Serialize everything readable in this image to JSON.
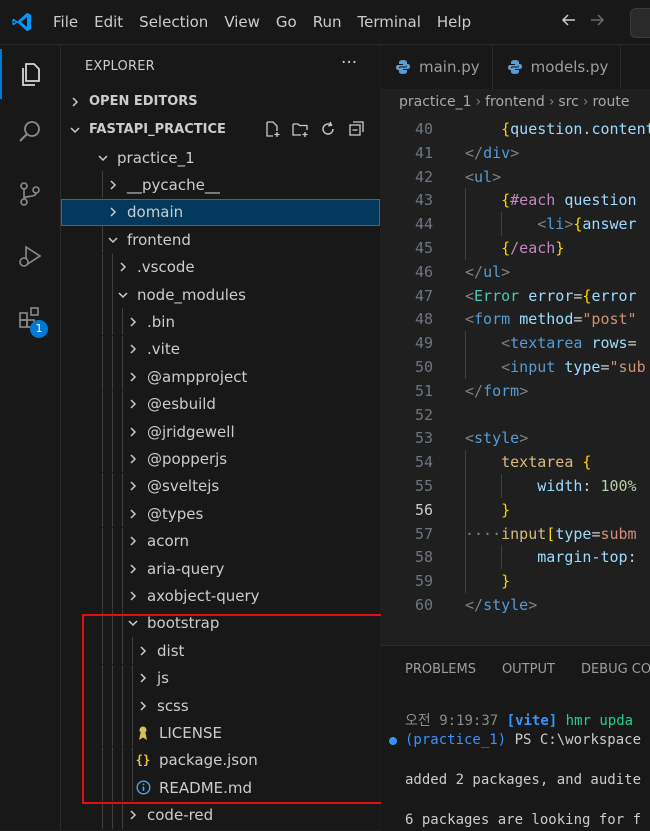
{
  "menu": [
    "File",
    "Edit",
    "Selection",
    "View",
    "Go",
    "Run",
    "Terminal",
    "Help"
  ],
  "activity": {
    "extensions_badge": "1"
  },
  "explorer": {
    "title": "EXPLORER",
    "more": "···",
    "open_editors": "OPEN EDITORS",
    "workspace": "FASTAPI_PRACTICE",
    "tree": [
      {
        "label": "practice_1",
        "depth": 0,
        "expanded": true
      },
      {
        "label": "__pycache__",
        "depth": 1,
        "expanded": false
      },
      {
        "label": "domain",
        "depth": 1,
        "expanded": false,
        "selected": true
      },
      {
        "label": "frontend",
        "depth": 1,
        "expanded": true
      },
      {
        "label": ".vscode",
        "depth": 2,
        "expanded": false
      },
      {
        "label": "node_modules",
        "depth": 2,
        "expanded": true
      },
      {
        "label": ".bin",
        "depth": 3,
        "expanded": false
      },
      {
        "label": ".vite",
        "depth": 3,
        "expanded": false
      },
      {
        "label": "@ampproject",
        "depth": 3,
        "expanded": false
      },
      {
        "label": "@esbuild",
        "depth": 3,
        "expanded": false
      },
      {
        "label": "@jridgewell",
        "depth": 3,
        "expanded": false
      },
      {
        "label": "@popperjs",
        "depth": 3,
        "expanded": false
      },
      {
        "label": "@sveltejs",
        "depth": 3,
        "expanded": false
      },
      {
        "label": "@types",
        "depth": 3,
        "expanded": false
      },
      {
        "label": "acorn",
        "depth": 3,
        "expanded": false
      },
      {
        "label": "aria-query",
        "depth": 3,
        "expanded": false
      },
      {
        "label": "axobject-query",
        "depth": 3,
        "expanded": false
      },
      {
        "label": "bootstrap",
        "depth": 3,
        "expanded": true
      },
      {
        "label": "dist",
        "depth": 4,
        "expanded": false
      },
      {
        "label": "js",
        "depth": 4,
        "expanded": false
      },
      {
        "label": "scss",
        "depth": 4,
        "expanded": false
      },
      {
        "label": "LICENSE",
        "depth": 4,
        "icon": "license-icon"
      },
      {
        "label": "package.json",
        "depth": 4,
        "icon": "json-icon"
      },
      {
        "label": "README.md",
        "depth": 4,
        "icon": "info-icon"
      },
      {
        "label": "code-red",
        "depth": 3,
        "expanded": false
      }
    ]
  },
  "editor": {
    "tabs": [
      "main.py",
      "models.py"
    ],
    "breadcrumb": [
      "practice_1",
      "frontend",
      "src",
      "route"
    ],
    "current_line": 56,
    "lines": [
      {
        "n": 40,
        "t": [
          [
            "",
            "    "
          ],
          [
            "brace",
            "{"
          ],
          [
            "var",
            "question"
          ],
          [
            "plain",
            "."
          ],
          [
            "var",
            "content"
          ]
        ]
      },
      {
        "n": 41,
        "t": [
          [
            "t",
            "</"
          ],
          [
            "tag",
            "div"
          ],
          [
            "t",
            ">"
          ]
        ]
      },
      {
        "n": 42,
        "t": [
          [
            "t",
            "<"
          ],
          [
            "tag",
            "ul"
          ],
          [
            "t",
            ">"
          ]
        ]
      },
      {
        "n": 43,
        "t": [
          [
            "",
            "    "
          ],
          [
            "brace",
            "{"
          ],
          [
            "kw",
            "#each"
          ],
          [
            "plain",
            " "
          ],
          [
            "var",
            "question"
          ]
        ]
      },
      {
        "n": 44,
        "t": [
          [
            "",
            "        "
          ],
          [
            "t",
            "<"
          ],
          [
            "tag",
            "li"
          ],
          [
            "t",
            ">"
          ],
          [
            "brace",
            "{"
          ],
          [
            "var",
            "answer"
          ]
        ]
      },
      {
        "n": 45,
        "t": [
          [
            "",
            "    "
          ],
          [
            "brace",
            "{"
          ],
          [
            "kw",
            "/each"
          ],
          [
            "brace",
            "}"
          ]
        ]
      },
      {
        "n": 46,
        "t": [
          [
            "t",
            "</"
          ],
          [
            "tag",
            "ul"
          ],
          [
            "t",
            ">"
          ]
        ]
      },
      {
        "n": 47,
        "t": [
          [
            "t",
            "<"
          ],
          [
            "cls",
            "Error"
          ],
          [
            "plain",
            " "
          ],
          [
            "attr",
            "error"
          ],
          [
            "plain",
            "="
          ],
          [
            "brace",
            "{"
          ],
          [
            "var",
            "error"
          ]
        ]
      },
      {
        "n": 48,
        "t": [
          [
            "t",
            "<"
          ],
          [
            "tag",
            "form"
          ],
          [
            "plain",
            " "
          ],
          [
            "attr",
            "method"
          ],
          [
            "plain",
            "="
          ],
          [
            "str",
            "\"post\""
          ]
        ]
      },
      {
        "n": 49,
        "t": [
          [
            "",
            "    "
          ],
          [
            "t",
            "<"
          ],
          [
            "tag",
            "textarea"
          ],
          [
            "plain",
            " "
          ],
          [
            "attr",
            "rows"
          ],
          [
            "plain",
            "="
          ]
        ]
      },
      {
        "n": 50,
        "t": [
          [
            "",
            "    "
          ],
          [
            "t",
            "<"
          ],
          [
            "tag",
            "input"
          ],
          [
            "plain",
            " "
          ],
          [
            "attr",
            "type"
          ],
          [
            "plain",
            "="
          ],
          [
            "str",
            "\"sub"
          ]
        ]
      },
      {
        "n": 51,
        "t": [
          [
            "t",
            "</"
          ],
          [
            "tag",
            "form"
          ],
          [
            "t",
            ">"
          ]
        ]
      },
      {
        "n": 52,
        "t": []
      },
      {
        "n": 53,
        "t": [
          [
            "t",
            "<"
          ],
          [
            "tag",
            "style"
          ],
          [
            "t",
            ">"
          ]
        ]
      },
      {
        "n": 54,
        "t": [
          [
            "",
            "    "
          ],
          [
            "sel",
            "textarea"
          ],
          [
            "plain",
            " "
          ],
          [
            "brace",
            "{"
          ]
        ]
      },
      {
        "n": 55,
        "t": [
          [
            "",
            "        "
          ],
          [
            "prop",
            "width"
          ],
          [
            "plain",
            ": "
          ],
          [
            "num",
            "100%"
          ]
        ]
      },
      {
        "n": 56,
        "t": [
          [
            "",
            "    "
          ],
          [
            "brace",
            "}"
          ]
        ]
      },
      {
        "n": 57,
        "t": [
          [
            "t",
            "····"
          ],
          [
            "sel",
            "input"
          ],
          [
            "brace",
            "["
          ],
          [
            "attr",
            "type"
          ],
          [
            "plain",
            "="
          ],
          [
            "str",
            "subm"
          ]
        ]
      },
      {
        "n": 58,
        "t": [
          [
            "",
            "        "
          ],
          [
            "prop",
            "margin-top"
          ],
          [
            "plain",
            ":"
          ]
        ]
      },
      {
        "n": 59,
        "t": [
          [
            "",
            "    "
          ],
          [
            "brace",
            "}"
          ]
        ]
      },
      {
        "n": 60,
        "t": [
          [
            "t",
            "</"
          ],
          [
            "tag",
            "style"
          ],
          [
            "t",
            ">"
          ]
        ]
      }
    ]
  },
  "panel": {
    "tabs": [
      "PROBLEMS",
      "OUTPUT",
      "DEBUG CO"
    ],
    "terminal": {
      "line1_time": "오전 9:19:37",
      "line1_tag": "[vite]",
      "line1_msg": "hmr upda",
      "line2_env": "(practice_1)",
      "line2_prompt": "PS C:\\workspace",
      "line3": "added 2 packages, and audite",
      "line4": "6 packages are looking for f"
    }
  }
}
